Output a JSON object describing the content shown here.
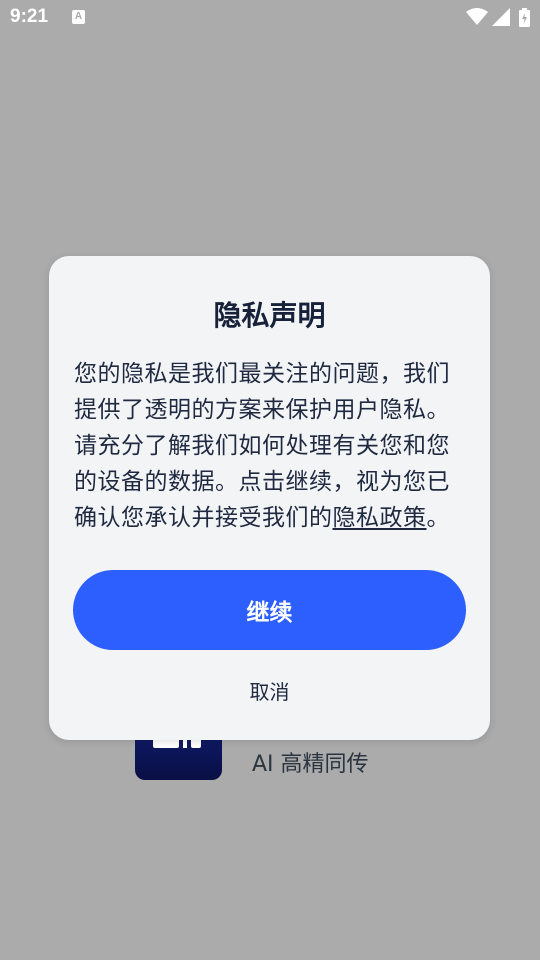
{
  "status_bar": {
    "time": "9:21",
    "notification_icon": "A",
    "icons": [
      "wifi-icon",
      "signal-icon",
      "battery-icon"
    ]
  },
  "background_app": {
    "name": "AI 高精同传",
    "icon": "app-icon"
  },
  "dialog": {
    "title": "隐私声明",
    "body_text": "您的隐私是我们最关注的问题，我们提供了透明的方案来保护用户隐私。请充分了解我们如何处理有关您和您的设备的数据。点击继续，视为您已确认您承认并接受我们的",
    "policy_link": "隐私政策",
    "body_end": "。",
    "continue_label": "继续",
    "cancel_label": "取消"
  },
  "colors": {
    "scrim": "#ababab",
    "dialog_bg": "#f2f4f6",
    "primary_button": "#2c5ffe",
    "text": "#1f2940"
  }
}
